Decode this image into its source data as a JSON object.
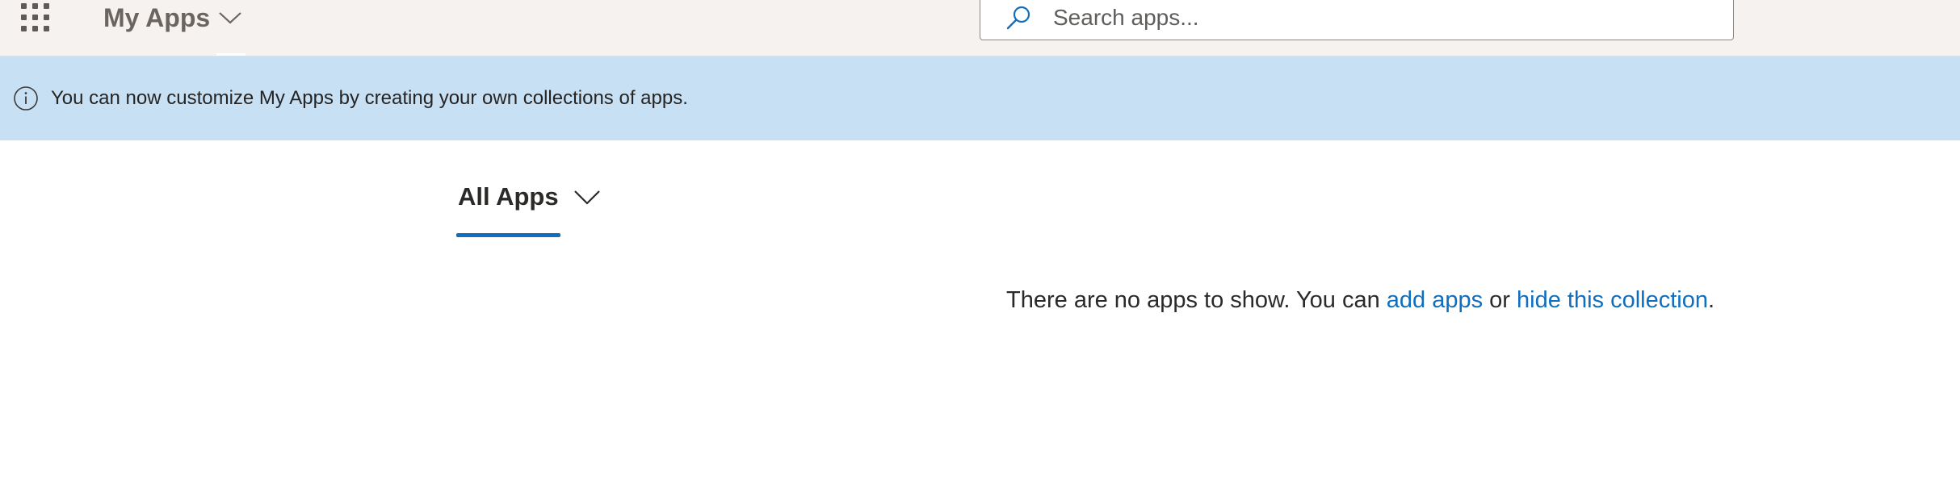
{
  "header": {
    "launcher_icon": "waffle-icon",
    "app_title": "My Apps",
    "title_chevron_icon": "chevron-down-icon",
    "search": {
      "icon": "search-icon",
      "placeholder": "Search apps..."
    }
  },
  "banner": {
    "icon": "info-icon",
    "message": "You can now customize My Apps by creating your own collections of apps.",
    "background_color": "#c7e0f4"
  },
  "collection": {
    "label": "All Apps",
    "chevron_icon": "chevron-down-icon",
    "accent_color": "#106ebe"
  },
  "empty_state": {
    "prefix": "There are no apps to show. You can ",
    "add_link": "add apps",
    "middle": " or ",
    "hide_link": "hide this collection",
    "suffix": "."
  }
}
